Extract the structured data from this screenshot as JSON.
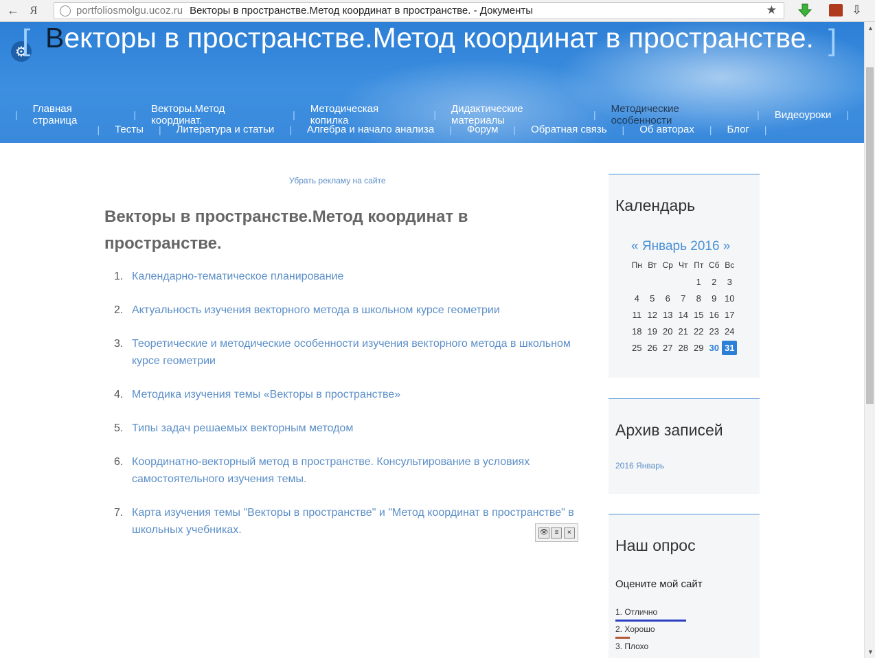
{
  "browser": {
    "host": "portfoliosmolgu.ucoz.ru",
    "tab_title": "Векторы в пространстве.Метод координат в пространстве. - Документы",
    "back_icon": "←",
    "yandex_icon": "Я",
    "star_icon": "★",
    "download_icon": "⇩"
  },
  "header": {
    "title_first": "В",
    "title_rest": "екторы в пространстве.Метод координат в пространстве.",
    "bracket_left": "[",
    "bracket_right": "]",
    "gear_icon": "⚙",
    "menu_row1": [
      "Главная страница",
      "Векторы.Метод координат.",
      "Методическая копилка",
      "Дидактические материалы",
      "Методические особенности",
      "Видеоуроки"
    ],
    "menu_row2": [
      "Тесты",
      "Литература и статьи",
      "Алгебра и начало анализа",
      "Форум",
      "Обратная связь",
      "Об авторах",
      "Блог"
    ],
    "active_item": "Методические особенности"
  },
  "main": {
    "ad_link": "Убрать рекламу на сайте",
    "title": "Векторы в пространстве.Метод координат в пространстве.",
    "items": [
      {
        "num": "1.",
        "text": "Календарно-тематическое планирование"
      },
      {
        "num": "2.",
        "text": "Актуальность изучения векторного метода в школьном курсе геометрии"
      },
      {
        "num": "3.",
        "text": "Теоретические и методические особенности изучения векторного метода в школьном курсе геометрии"
      },
      {
        "num": "4.",
        "text": "Методика изучения темы «Векторы в пространстве»"
      },
      {
        "num": "5.",
        "text": "Типы задач решаемых векторным методом"
      },
      {
        "num": "6.",
        "text": "Координатно-векторный метод в пространстве. Консультирование в условиях самостоятельного изучения темы."
      },
      {
        "num": "7.",
        "text": "Карта изучения темы \"Векторы в пространстве\" и \"Метод координат в пространстве\" в школьных учебниках."
      }
    ]
  },
  "sidebar": {
    "calendar": {
      "title": "Календарь",
      "nav": "« Январь 2016 »",
      "days": [
        "Пн",
        "Вт",
        "Ср",
        "Чт",
        "Пт",
        "Сб",
        "Вс"
      ],
      "weeks": [
        [
          "",
          "",
          "",
          "",
          "1",
          "2",
          "3"
        ],
        [
          "4",
          "5",
          "6",
          "7",
          "8",
          "9",
          "10"
        ],
        [
          "11",
          "12",
          "13",
          "14",
          "15",
          "16",
          "17"
        ],
        [
          "18",
          "19",
          "20",
          "21",
          "22",
          "23",
          "24"
        ],
        [
          "25",
          "26",
          "27",
          "28",
          "29",
          "30",
          "31"
        ]
      ],
      "highlighted": "30",
      "today": "31"
    },
    "archive": {
      "title": "Архив записей",
      "link": "2016 Январь"
    },
    "poll": {
      "title": "Наш опрос",
      "question": "Оцените мой сайт",
      "options": [
        {
          "label": "1. Отлично",
          "color": "#2a3fbf",
          "share": 1.0
        },
        {
          "label": "2. Хорошо",
          "color": "#b05a3a",
          "share": 0.2
        },
        {
          "label": "3. Плохо",
          "color": "#999999",
          "share": 0.0
        }
      ]
    }
  }
}
